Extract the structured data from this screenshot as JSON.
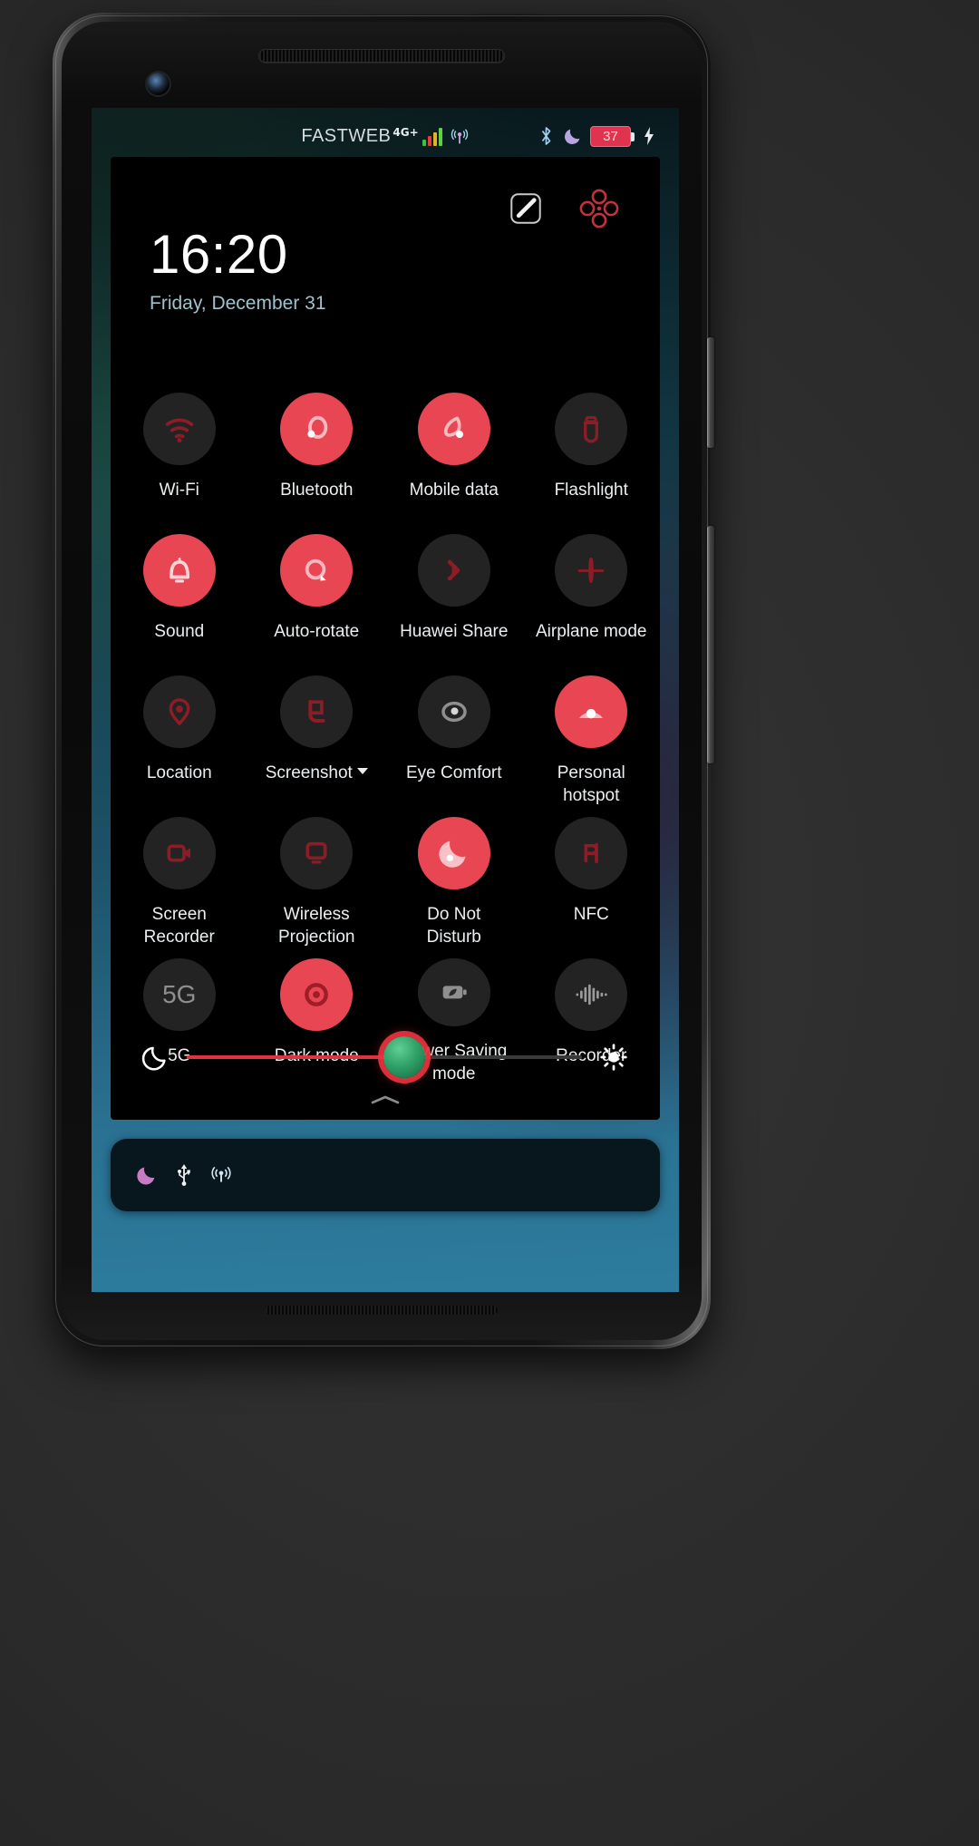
{
  "theme": {
    "accent_on": "#e94653",
    "bubble_off": "#232323",
    "panel_bg": "#000000",
    "battery_red": "#e0334f",
    "date_color": "#9fc3cd",
    "slider_fill": "#e1333f",
    "thumb_green": "#2f9e66",
    "wallpaper_top": "#0e2320",
    "wallpaper_bottom": "#2d7c9e"
  },
  "statusbar": {
    "carrier": "FASTWEB",
    "network_type": "4G+",
    "signal_bars": 4,
    "signal_colors": [
      "#39c24a",
      "#e0403a",
      "#e8b21f",
      "#5dd43f"
    ],
    "hotspot_icon": "hotspot-icon",
    "bluetooth_icon": "bluetooth-icon",
    "dnd_icon": "moon-icon",
    "battery_percent": "37",
    "charging_icon": "charging-bolt-icon"
  },
  "quick_settings": {
    "time": "16:20",
    "date": "Friday, December 31",
    "edit_icon": "edit-pencil-icon",
    "shortcuts_icon": "grid-shortcuts-icon",
    "tiles": [
      {
        "label": "Wi-Fi",
        "icon": "wifi-icon",
        "state": "off"
      },
      {
        "label": "Bluetooth",
        "icon": "bluetooth-icon",
        "state": "on"
      },
      {
        "label": "Mobile data",
        "icon": "mobile-data-icon",
        "state": "on"
      },
      {
        "label": "Flashlight",
        "icon": "flashlight-icon",
        "state": "off"
      },
      {
        "label": "Sound",
        "icon": "bell-icon",
        "state": "on"
      },
      {
        "label": "Auto-rotate",
        "icon": "auto-rotate-icon",
        "state": "on"
      },
      {
        "label": "Huawei Share",
        "icon": "huawei-share-icon",
        "state": "off"
      },
      {
        "label": "Airplane mode",
        "icon": "airplane-mode-icon",
        "state": "off"
      },
      {
        "label": "Location",
        "icon": "location-pin-icon",
        "state": "off"
      },
      {
        "label": "Screenshot",
        "icon": "screenshot-icon",
        "state": "off",
        "has_dropdown": true
      },
      {
        "label": "Eye Comfort",
        "icon": "eye-comfort-icon",
        "state": "off"
      },
      {
        "label": "Personal\nhotspot",
        "icon": "personal-hotspot-icon",
        "state": "on"
      },
      {
        "label": "Screen\nRecorder",
        "icon": "screen-recorder-icon",
        "state": "off"
      },
      {
        "label": "Wireless\nProjection",
        "icon": "wireless-projection-icon",
        "state": "off"
      },
      {
        "label": "Do Not\nDisturb",
        "icon": "do-not-disturb-icon",
        "state": "on"
      },
      {
        "label": "NFC",
        "icon": "nfc-icon",
        "state": "off"
      },
      {
        "label": "5G",
        "icon": "five-g-icon",
        "state": "off",
        "glyph": "5G"
      },
      {
        "label": "Dark mode",
        "icon": "dark-mode-icon",
        "state": "on"
      },
      {
        "label": "Power Saving\nmode",
        "icon": "power-saving-icon",
        "state": "off"
      },
      {
        "label": "Recorder",
        "icon": "recorder-icon",
        "state": "off"
      }
    ],
    "brightness": {
      "low_icon": "moon-brightness-icon",
      "high_icon": "sun-brightness-icon",
      "value_percent": 55,
      "expand_icon": "chevron-up-icon"
    }
  },
  "notification_shade": {
    "icons": [
      "dnd-moon-icon",
      "usb-icon",
      "hotspot-icon"
    ]
  }
}
